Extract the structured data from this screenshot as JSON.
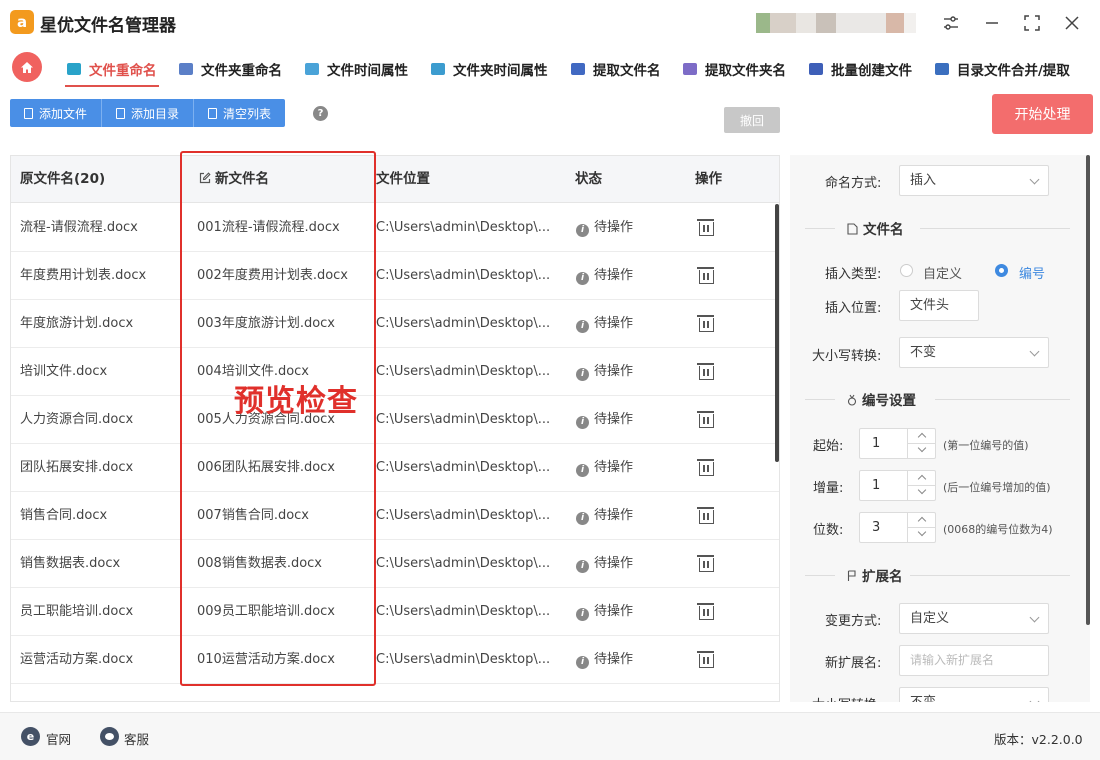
{
  "app": {
    "title": "星优文件名管理器",
    "logo_text": "a"
  },
  "tabs": [
    {
      "label": "文件重命名",
      "active": true,
      "icon_color": "#29a3c9"
    },
    {
      "label": "文件夹重命名",
      "active": false,
      "icon_color": "#5b7fc7"
    },
    {
      "label": "文件时间属性",
      "active": false,
      "icon_color": "#4aa3d8"
    },
    {
      "label": "文件夹时间属性",
      "active": false,
      "icon_color": "#3c9ccf"
    },
    {
      "label": "提取文件名",
      "active": false,
      "icon_color": "#4169c2"
    },
    {
      "label": "提取文件夹名",
      "active": false,
      "icon_color": "#7d6cc7"
    },
    {
      "label": "批量创建文件",
      "active": false,
      "icon_color": "#3e5fb8"
    },
    {
      "label": "目录文件合并/提取",
      "active": false,
      "icon_color": "#3b6fbf"
    }
  ],
  "toolbar": {
    "add_file": "添加文件",
    "add_dir": "添加目录",
    "clear_list": "清空列表",
    "help": "?",
    "undo": "撤回",
    "start": "开始处理"
  },
  "table": {
    "headers": {
      "original": "原文件名(20)",
      "new": "新文件名",
      "location": "文件位置",
      "status": "状态",
      "action": "操作"
    },
    "rows": [
      {
        "original": "流程-请假流程.docx",
        "new": "001流程-请假流程.docx",
        "location": "C:\\Users\\admin\\Desktop\\...",
        "status": "待操作"
      },
      {
        "original": "年度费用计划表.docx",
        "new": "002年度费用计划表.docx",
        "location": "C:\\Users\\admin\\Desktop\\...",
        "status": "待操作"
      },
      {
        "original": "年度旅游计划.docx",
        "new": "003年度旅游计划.docx",
        "location": "C:\\Users\\admin\\Desktop\\...",
        "status": "待操作"
      },
      {
        "original": "培训文件.docx",
        "new": "004培训文件.docx",
        "location": "C:\\Users\\admin\\Desktop\\...",
        "status": "待操作"
      },
      {
        "original": "人力资源合同.docx",
        "new": "005人力资源合同.docx",
        "location": "C:\\Users\\admin\\Desktop\\...",
        "status": "待操作"
      },
      {
        "original": "团队拓展安排.docx",
        "new": "006团队拓展安排.docx",
        "location": "C:\\Users\\admin\\Desktop\\...",
        "status": "待操作"
      },
      {
        "original": "销售合同.docx",
        "new": "007销售合同.docx",
        "location": "C:\\Users\\admin\\Desktop\\...",
        "status": "待操作"
      },
      {
        "original": "销售数据表.docx",
        "new": "008销售数据表.docx",
        "location": "C:\\Users\\admin\\Desktop\\...",
        "status": "待操作"
      },
      {
        "original": "员工职能培训.docx",
        "new": "009员工职能培训.docx",
        "location": "C:\\Users\\admin\\Desktop\\...",
        "status": "待操作"
      },
      {
        "original": "运营活动方案.docx",
        "new": "010运营活动方案.docx",
        "location": "C:\\Users\\admin\\Desktop\\...",
        "status": "待操作"
      }
    ]
  },
  "annotation": "预览检查",
  "settings": {
    "naming_method_label": "命名方式:",
    "naming_method_value": "插入",
    "filename_section": "文件名",
    "insert_type_label": "插入类型:",
    "insert_type_opt1": "自定义",
    "insert_type_opt2": "编号",
    "insert_pos_label": "插入位置:",
    "insert_pos_value": "文件头",
    "case_label": "大小写转换:",
    "case_value": "不变",
    "numbering_section": "编号设置",
    "start_label": "起始:",
    "start_value": "1",
    "start_hint": "(第一位编号的值)",
    "step_label": "增量:",
    "step_value": "1",
    "step_hint": "(后一位编号增加的值)",
    "digits_label": "位数:",
    "digits_value": "3",
    "digits_hint": "(0068的编号位数为4)",
    "ext_section": "扩展名",
    "change_method_label": "变更方式:",
    "change_method_value": "自定义",
    "new_ext_label": "新扩展名:",
    "new_ext_placeholder": "请输入新扩展名",
    "ext_case_label": "大小写转换:",
    "ext_case_value": "不变"
  },
  "footer": {
    "website": "官网",
    "service": "客服",
    "version": "版本：v2.2.0.0"
  }
}
